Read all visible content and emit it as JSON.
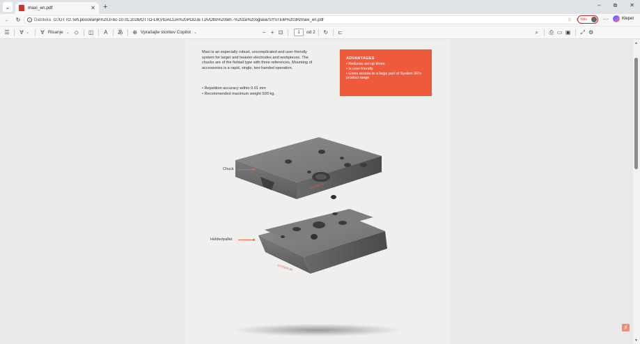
{
  "tab": {
    "title": "maxi_en.pdf",
    "close": "✕",
    "new": "+"
  },
  "window": {
    "minimize": "–",
    "maximize": "⧉",
    "close": "✕"
  },
  "address": {
    "prefix": "Datoteka",
    "url": "G:/OTTO.Teh.poslovanje%20JI-bc-10.01.2026/OTTO-LIKVIDACIJA%20PODJETJA/Otto%20teh.-%20za%20oglase/SYSTEM%203R/maxi_en.pdf",
    "signin_label": "Vpis",
    "more": "···",
    "copilot_label": "Klepet"
  },
  "toolbar": {
    "draw_label": "Risanje",
    "copilot_label": "Vprašajte storitev Copilot",
    "zoom_out": "−",
    "zoom_in": "+",
    "page_current": "1",
    "page_total": "od 2"
  },
  "document": {
    "intro": "Maxi is an especially robust, uncomplicated and user-friendly system for larger and heavier electrodes and workpieces. The chucks are of the fishtail type with three references. Mounting of accessories is a rapid, single, two-handed operation.",
    "bullets": [
      "Repetition accuracy within 0.01 mm",
      "Recommended maximum weight 500 kg."
    ],
    "advantages": {
      "title": "ADVANTAGES",
      "items": [
        "Reduces set-up times",
        "Is user-friendly",
        "Gives access to a large part of System 3R's product range"
      ]
    },
    "labels": {
      "chuck": "Chuck",
      "holder": "Holder/pallet"
    }
  },
  "colors": {
    "accent": "#f05a3c",
    "page": "#f0efed",
    "viewer": "#e9e9e9"
  },
  "icons": [
    "menu-icon",
    "pdf-icon",
    "back-icon",
    "refresh-icon",
    "info-icon",
    "star-icon",
    "favorites-icon",
    "copilot-icon",
    "list-icon",
    "highlight-icon",
    "draw-icon",
    "eraser-icon",
    "view-icon",
    "read-aloud-icon",
    "translate-icon",
    "fit-page-icon",
    "rotate-icon",
    "two-page-icon",
    "search-icon",
    "print-icon",
    "save-icon",
    "save-as-icon",
    "fullscreen-icon",
    "settings-icon",
    "acrobat-icon"
  ]
}
